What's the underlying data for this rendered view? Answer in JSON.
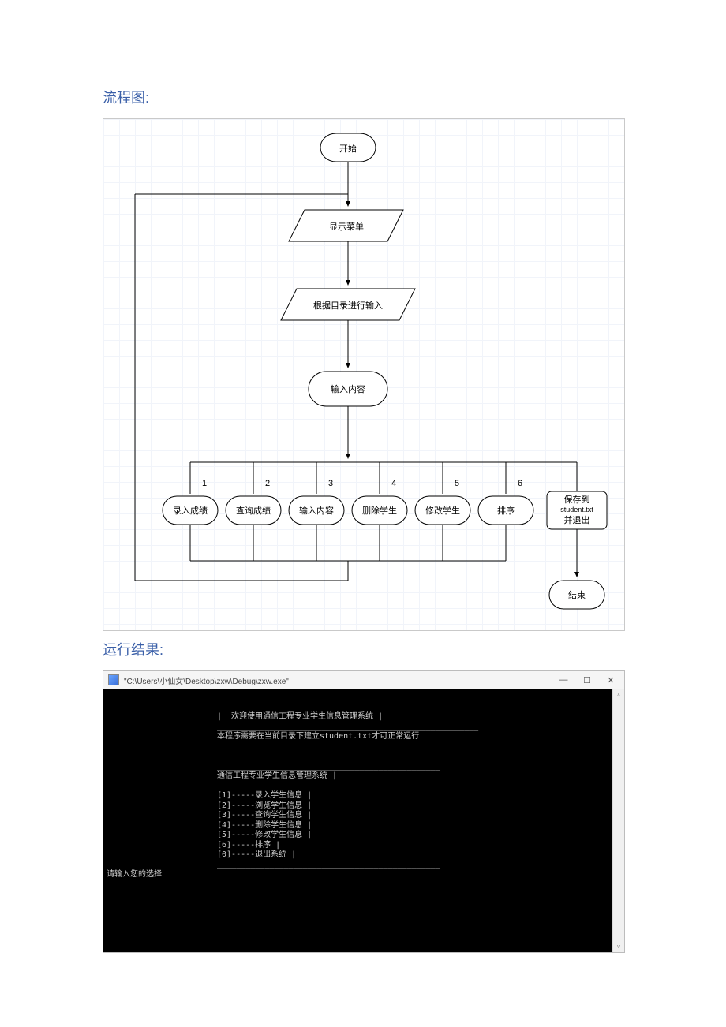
{
  "headings": {
    "flowchart": "流程图:",
    "result": "运行结果:"
  },
  "flowchart": {
    "start": "开始",
    "show_menu": "显示菜单",
    "input_by_dir": "根据目录进行输入",
    "input_content": "输入内容",
    "branches": {
      "n1": "1",
      "n2": "2",
      "n3": "3",
      "n4": "4",
      "n5": "5",
      "n6": "6",
      "opt1": "录入成绩",
      "opt2": "查询成绩",
      "opt3": "输入内容",
      "opt4": "删除学生",
      "opt5": "修改学生",
      "opt6": "排序",
      "save_l1": "保存到",
      "save_l2": "student.txt",
      "save_l3": "并退出"
    },
    "end": "结束"
  },
  "console": {
    "title": "\"C:\\Users\\小仙女\\Desktop\\zxw\\Debug\\zxw.exe\"",
    "lines": {
      "hr": "_______________________________________________________",
      "welcome": "|  欢迎使用通信工程专业学生信息管理系统 |",
      "note": "本程序需要在当前目录下建立student.txt才可正常运行",
      "hr2": "_______________________________________________",
      "systitle": "通信工程专业学生信息管理系统 |",
      "m1": "[1]-----录入学生信息 |",
      "m2": "[2]-----浏览学生信息 |",
      "m3": "[3]-----查询学生信息 |",
      "m4": "[4]-----删除学生信息 |",
      "m5": "[5]-----修改学生信息 |",
      "m6": "[6]-----排序 |",
      "m0": "[0]-----退出系统 |",
      "prompt": "请输入您的选择"
    }
  }
}
